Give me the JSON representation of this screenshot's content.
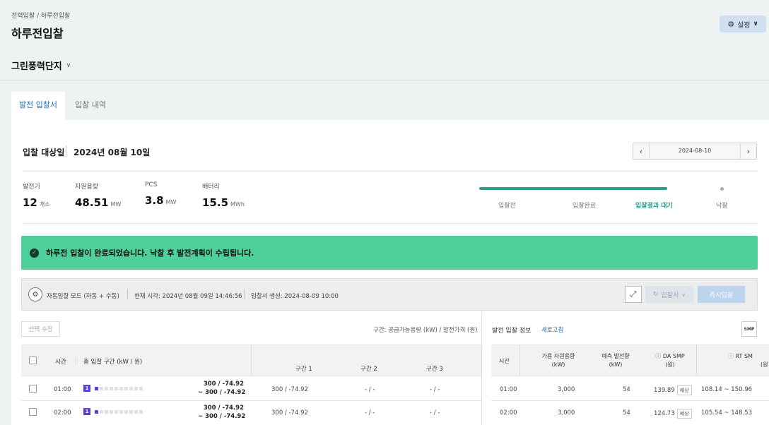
{
  "header": {
    "breadcrumb": "전력입찰 / 하루전입찰",
    "title": "하루전입찰",
    "settings_label": "설정",
    "complex_name": "그린풍력단지"
  },
  "tabs": [
    {
      "label": "발전 입찰서",
      "active": true
    },
    {
      "label": "입찰 내역",
      "active": false
    }
  ],
  "target": {
    "label": "입찰 대상일",
    "date": "2024년 08월 10일",
    "nav_date": "2024-08-10"
  },
  "stats": [
    {
      "label": "발전기",
      "value": "12",
      "unit": "개소"
    },
    {
      "label": "자원용량",
      "value": "48.51",
      "unit": "MW"
    },
    {
      "label": "PCS",
      "value": "3.8",
      "unit": "MW"
    },
    {
      "label": "배터리",
      "value": "15.5",
      "unit": "MWh"
    }
  ],
  "steps": [
    "입찰전",
    "입찰완료",
    "입찰결과 대기",
    "낙찰"
  ],
  "active_step": 2,
  "banner": {
    "message": "하루전 입찰이 완료되었습니다. 낙찰 후 발전계획이 수립됩니다.",
    "color": "#4fd09a"
  },
  "mode_bar": {
    "mode": "자동입찰 모드 (자동 + 수동)",
    "current_time": "현재 시각: 2024년 08월 09일 14:46:56",
    "created": "입찰서 생성: 2024-08-09 10:00",
    "bid_label": "입찰서",
    "instant_label": "즉시입찰"
  },
  "left_table": {
    "edit_label": "선택 수정",
    "range_note": "구간: 공급가능용량 (kW) / 발전가격 (원)",
    "headers": {
      "time": "시간",
      "total": "총 입찰 구간 (kW / 원)",
      "s1": "구간 1",
      "s2": "구간 2",
      "s3": "구간 3"
    },
    "rows": [
      {
        "time": "01:00",
        "badge": "1",
        "range_top": "300 / -74.92",
        "range_bottom": "~ 300 / -74.92",
        "s1": "300 / -74.92",
        "s2": "- / -",
        "s3": "- / -"
      },
      {
        "time": "02:00",
        "badge": "1",
        "range_top": "300 / -74.92",
        "range_bottom": "~ 300 / -74.92",
        "s1": "300 / -74.92",
        "s2": "- / -",
        "s3": "- / -"
      }
    ]
  },
  "right_table": {
    "title": "발전 입찰 정보",
    "refresh": "새로고침",
    "smp_label": "SMP",
    "headers": {
      "time": "시간",
      "avail_1": "가용 자원용량",
      "avail_2": "(kW)",
      "pred_1": "예측 발전량",
      "pred_2": "(kW)",
      "da_1": "DA SMP",
      "da_2": "(원)",
      "rt_1": "RT SM",
      "rt_2": "(원"
    },
    "rows": [
      {
        "time": "01:00",
        "avail": "3,000",
        "pred": "54",
        "da": "139.89",
        "da_tag": "예상",
        "rt": "108.14 ~ 150.96"
      },
      {
        "time": "02:00",
        "avail": "3,000",
        "pred": "54",
        "da": "124.73",
        "da_tag": "예상",
        "rt": "105.54 ~ 148.53"
      }
    ]
  }
}
